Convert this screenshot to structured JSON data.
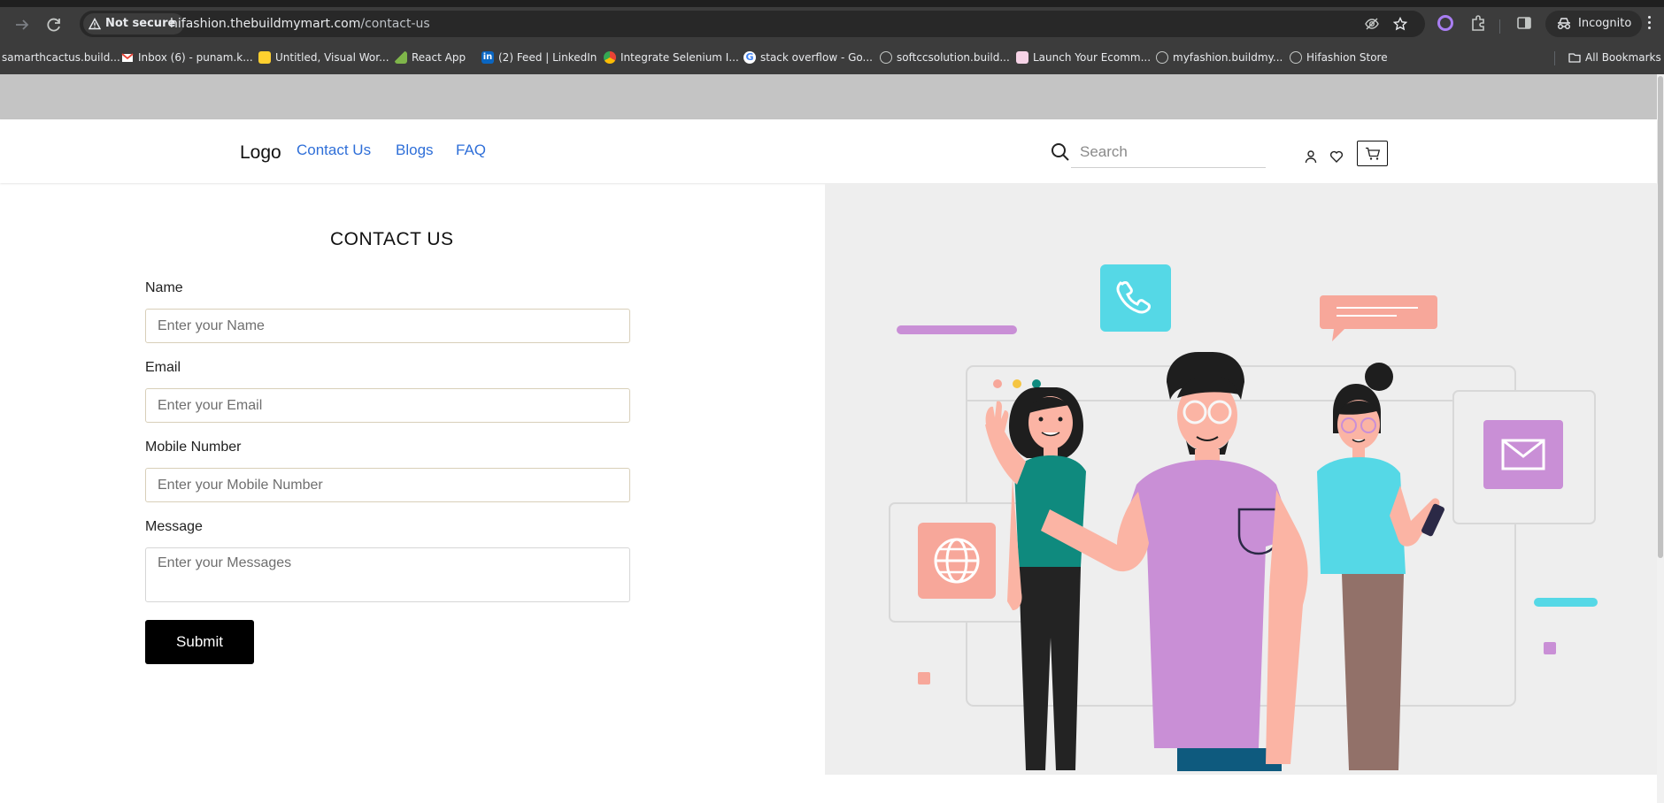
{
  "browser": {
    "security_label": "Not secure",
    "url_host": "hifashion.thebuildmymart.com",
    "url_path": "/contact-us",
    "incognito_label": "Incognito",
    "all_bookmarks_label": "All Bookmarks",
    "bookmarks": [
      {
        "label": "samarthcactus.build...",
        "icon": "globe-icon"
      },
      {
        "label": "Inbox (6) - punam.k...",
        "icon": "gmail-icon"
      },
      {
        "label": "Untitled, Visual Wor...",
        "icon": "miro-icon"
      },
      {
        "label": "React App",
        "icon": "react-app-icon"
      },
      {
        "label": "(2) Feed | LinkedIn",
        "icon": "linkedin-icon"
      },
      {
        "label": "Integrate Selenium I...",
        "icon": "chrome-icon"
      },
      {
        "label": "stack overflow - Go...",
        "icon": "google-icon"
      },
      {
        "label": "softccsolution.build...",
        "icon": "globe-icon"
      },
      {
        "label": "Launch Your Ecomm...",
        "icon": "shop-icon"
      },
      {
        "label": "myfashion.buildmy...",
        "icon": "globe-icon"
      },
      {
        "label": "Hifashion Store",
        "icon": "globe-icon"
      }
    ]
  },
  "header": {
    "logo": "Logo",
    "nav": [
      "Contact Us",
      "Blogs",
      "FAQ"
    ],
    "search_placeholder": "Search",
    "icons": [
      "search-icon",
      "user-icon",
      "heart-icon",
      "cart-icon"
    ]
  },
  "form": {
    "title": "CONTACT US",
    "name_label": "Name",
    "name_placeholder": "Enter your Name",
    "email_label": "Email",
    "email_placeholder": "Enter your Email",
    "mobile_label": "Mobile Number",
    "mobile_placeholder": "Enter your Mobile Number",
    "message_label": "Message",
    "message_placeholder": "Enter your Messages",
    "submit_label": "Submit"
  },
  "colors": {
    "nav_link": "#2f6fd8",
    "chrome_bg": "#3c3c3c",
    "promo_strip": "#c4c4c4",
    "panel_bg": "#eeeeee",
    "button_bg": "#000000"
  }
}
